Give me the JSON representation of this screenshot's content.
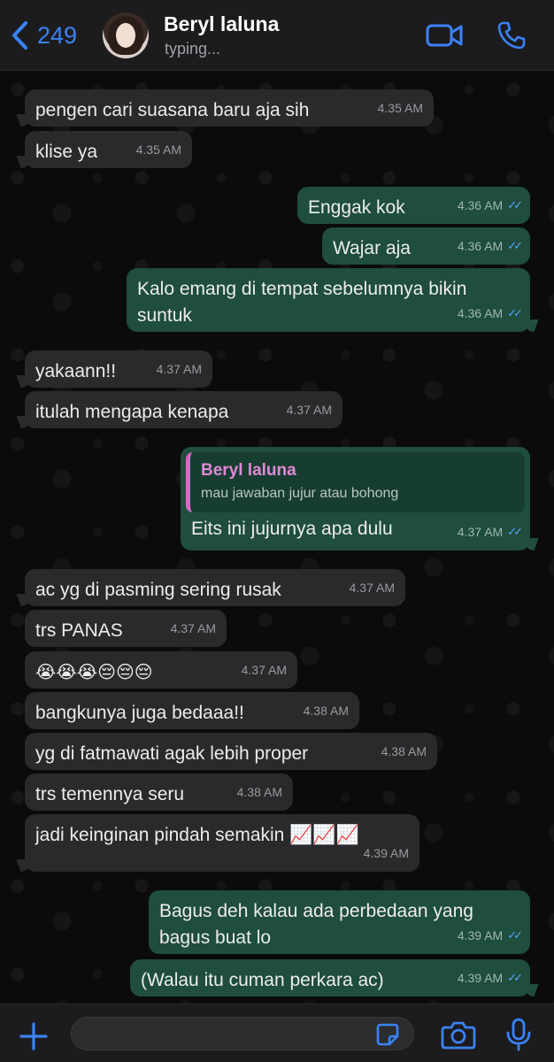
{
  "header": {
    "back_count": "249",
    "contact_name": "Beryl laluna",
    "status": "typing..."
  },
  "messages": [
    {
      "dir": "in",
      "text": "pengen cari suasana baru aja sih",
      "time": "4.35 AM"
    },
    {
      "dir": "in",
      "text": "klise ya",
      "time": "4.35 AM"
    },
    {
      "dir": "out",
      "text": "Enggak kok",
      "time": "4.36 AM"
    },
    {
      "dir": "out",
      "text": "Wajar aja",
      "time": "4.36 AM"
    },
    {
      "dir": "out",
      "text": "Kalo emang di tempat sebelumnya bikin suntuk",
      "time": "4.36 AM"
    },
    {
      "dir": "in",
      "text": "yakaann!!",
      "time": "4.37 AM"
    },
    {
      "dir": "in",
      "text": "itulah mengapa kenapa",
      "time": "4.37 AM"
    },
    {
      "dir": "out",
      "quote_name": "Beryl laluna",
      "quote_text": "mau jawaban jujur atau bohong",
      "text": "Eits ini jujurnya apa dulu",
      "time": "4.37 AM"
    },
    {
      "dir": "in",
      "text": "ac yg di pasming sering rusak",
      "time": "4.37 AM"
    },
    {
      "dir": "in",
      "text": "trs PANAS",
      "time": "4.37 AM"
    },
    {
      "dir": "in",
      "text": "😭😭😭😔😔😔",
      "time": "4.37 AM"
    },
    {
      "dir": "in",
      "text": "bangkunya juga bedaaa!!",
      "time": "4.38 AM"
    },
    {
      "dir": "in",
      "text": "yg di fatmawati agak lebih proper",
      "time": "4.38 AM"
    },
    {
      "dir": "in",
      "text": "trs temennya seru",
      "time": "4.38 AM"
    },
    {
      "dir": "in",
      "text": "jadi keinginan pindah semakin 📈📈📈",
      "time": "4.39 AM"
    },
    {
      "dir": "out",
      "text": "Bagus deh kalau ada perbedaan yang bagus buat lo",
      "time": "4.39 AM"
    },
    {
      "dir": "out",
      "text": "(Walau itu cuman perkara ac)",
      "time": "4.39 AM"
    }
  ],
  "ticks": "✓✓",
  "colors": {
    "accent": "#3b82f6",
    "incoming_bubble": "#2a2a2c",
    "outgoing_bubble": "#1f4d3e",
    "read_ticks": "#53a6ff",
    "quote_bar": "#d76ac6"
  },
  "icons": [
    "back-chevron-icon",
    "video-call-icon",
    "phone-icon",
    "plus-icon",
    "sticker-icon",
    "camera-icon",
    "microphone-icon"
  ]
}
